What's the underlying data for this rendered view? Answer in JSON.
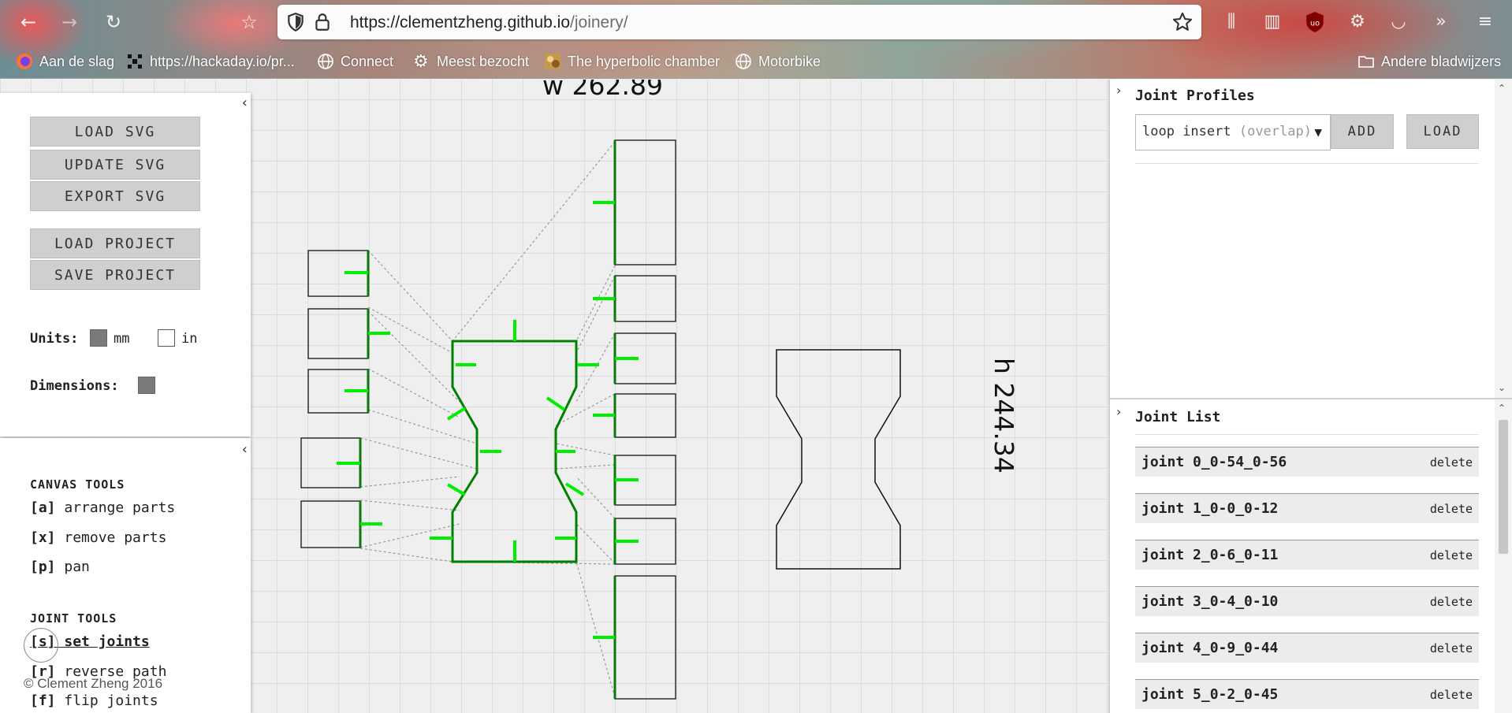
{
  "browser": {
    "url_host": "https://clementzheng.github.io",
    "url_path": "/joinery/",
    "bookmarks": [
      {
        "label": "Aan de slag",
        "icon": "firefox-icon"
      },
      {
        "label": "https://hackaday.io/pr...",
        "icon": "hackaday-icon"
      },
      {
        "label": "Connect",
        "icon": "globe-icon"
      },
      {
        "label": "Meest bezocht",
        "icon": "gear-icon"
      },
      {
        "label": "The hyperbolic chamber",
        "icon": "image-icon"
      },
      {
        "label": "Motorbike",
        "icon": "globe-icon"
      }
    ],
    "other_bookmarks": "Andere bladwijzers"
  },
  "canvas": {
    "width_label": "w 262.89",
    "height_label": "h 244.34",
    "joint_color": "#00ee00",
    "outline_color": "#008000"
  },
  "left_panel": {
    "buttons": {
      "load_svg": "LOAD SVG",
      "update_svg": "UPDATE SVG",
      "export_svg": "EXPORT SVG",
      "load_project": "LOAD PROJECT",
      "save_project": "SAVE PROJECT"
    },
    "units_label": "Units:",
    "unit_mm": "mm",
    "unit_in": "in",
    "dimensions_label": "Dimensions:"
  },
  "tools_panel": {
    "canvas_tools_title": "CANVAS TOOLS",
    "canvas_tools": [
      {
        "key": "[a]",
        "label": "arrange parts"
      },
      {
        "key": "[x]",
        "label": "remove parts"
      },
      {
        "key": "[p]",
        "label": "pan"
      }
    ],
    "joint_tools_title": "JOINT TOOLS",
    "joint_tools": [
      {
        "key": "[s]",
        "label": "set joints"
      },
      {
        "key": "[r]",
        "label": "reverse path"
      },
      {
        "key": "[f]",
        "label": "flip joints"
      }
    ],
    "copyright": "© Clement Zheng 2016"
  },
  "joint_profiles": {
    "title": "Joint Profiles",
    "select_value": "loop insert",
    "select_hint": "(overlap)",
    "add_label": "ADD",
    "load_label": "LOAD"
  },
  "joint_list": {
    "title": "Joint List",
    "delete_label": "delete",
    "items": [
      "joint 0_0-54_0-56",
      "joint 1_0-0_0-12",
      "joint 2_0-6_0-11",
      "joint 3_0-4_0-10",
      "joint 4_0-9_0-44",
      "joint 5_0-2_0-45"
    ]
  }
}
